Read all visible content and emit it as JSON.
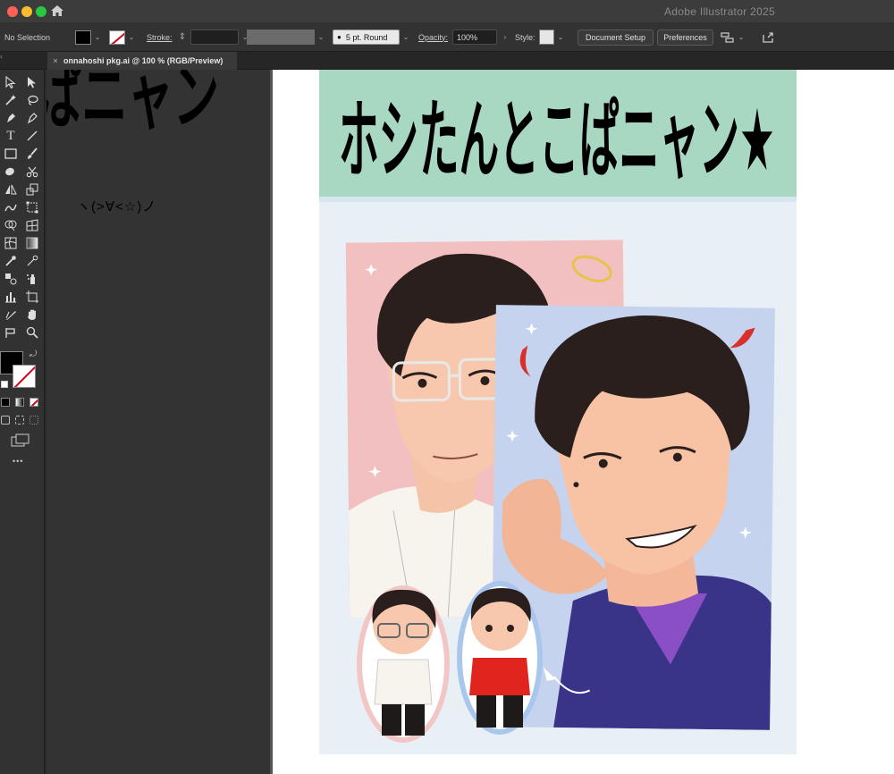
{
  "window": {
    "app_title": "Adobe Illustrator 2025"
  },
  "control_bar": {
    "selection_label": "No Selection",
    "fill_color": "#000000",
    "stroke_label": "Stroke:",
    "brush_label": "5 pt. Round",
    "opacity_label": "Opacity:",
    "opacity_value": "100%",
    "style_label": "Style:",
    "document_setup_label": "Document Setup",
    "preferences_label": "Preferences"
  },
  "tab": {
    "title": "onnahoshi pkg.ai @ 100 % (RGB/Preview)",
    "close_glyph": "×"
  },
  "pasteboard": {
    "title_fragment": "ぱニャン",
    "kaomoji": "ヽ(>∀<☆)ノ"
  },
  "artboard": {
    "title": "ホシたんとこぱニャン★",
    "colors": {
      "banner": "#a9d8c2",
      "background": "#e8eff5",
      "pink_card": "#f2c0c0",
      "blue_card": "#c6d3ee",
      "shirt_purple": "#3a3488",
      "horn_red": "#d9302b",
      "halo_gold": "#e8c24a"
    }
  },
  "tools_more_glyph": "•••"
}
